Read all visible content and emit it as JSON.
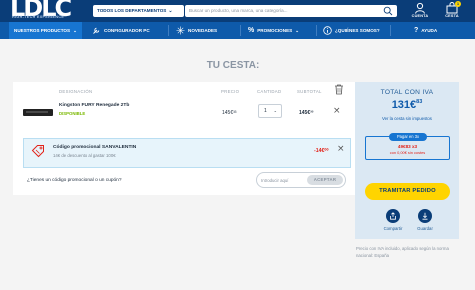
{
  "header": {
    "logo_letters": "LDLC",
    "logo_tagline": "HIGH-TECH EXPERIENCE",
    "departments_label": "TODOS LOS DEPARTAMENTOS",
    "search_placeholder": "Buscar un producto, una marca, una categoría...",
    "account_label": "CUENTA",
    "cart_label": "CESTA",
    "cart_count": "1"
  },
  "nav": {
    "items": [
      {
        "label": "NUESTROS PRODUCTOS",
        "icon": "chevron-down-icon"
      },
      {
        "label": "CONFIGURADOR PC",
        "icon": "wrench-icon"
      },
      {
        "label": "NOVEDADES",
        "icon": "sparkle-icon"
      },
      {
        "label": "PROMOCIONES",
        "icon": "percent-icon"
      },
      {
        "label": "¿QUIÉNES SOMOS?",
        "icon": "info-icon"
      },
      {
        "label": "AYUDA",
        "icon": "question-icon"
      }
    ]
  },
  "cart": {
    "title": "TU CESTA:",
    "columns": {
      "designation": "DESIGNACIÓN",
      "price": "PRECIO",
      "quantity": "CANTIDAD",
      "subtotal": "SUBTOTAL"
    },
    "item": {
      "name": "Kingston FURY Renegade 2Tb",
      "stock": "DISPONIBLE",
      "price": "145€³³",
      "quantity": "1",
      "subtotal": "145€³³"
    },
    "promo": {
      "title": "Código promocional SANVALENTIN",
      "description": "14€ de descuento al gastar 100€",
      "amount": "-14€⁰⁰"
    },
    "coupon": {
      "question": "¿Tienes un código promocional o un cupón?",
      "placeholder": "Introducir aquí",
      "apply_label": "ACEPTAR"
    }
  },
  "summary": {
    "title": "TOTAL CON IVA",
    "total_main": "131€",
    "total_cents": "83",
    "subtitle": "Ver la cesta sin impuestos",
    "finance_tag": "Pagar en 3x",
    "finance_amount": "49€83 x3",
    "finance_note": "con 0,00€ sin costes",
    "checkout_label": "TRAMITAR PEDIDO",
    "share_label": "Compartir",
    "save_label": "Guardar",
    "legal": "Precio con IVA incluido, aplicado según la norma nacional: España"
  },
  "colors": {
    "header_dark": "#0a3d78",
    "nav_blue": "#0e5aaa",
    "accent_yellow": "#ffd400",
    "stock_green": "#7ab800",
    "discount_red": "#e2231a",
    "summary_bg": "#dbe8f3"
  }
}
